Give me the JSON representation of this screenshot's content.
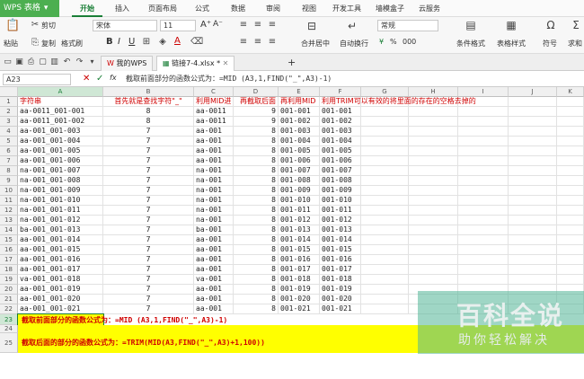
{
  "app": {
    "name": "WPS 表格",
    "dropdown": "▾"
  },
  "menu_tabs": [
    "开始",
    "插入",
    "页面布局",
    "公式",
    "数据",
    "审阅",
    "视图",
    "开发工具",
    "墙模盒子",
    "云服务"
  ],
  "ribbon": {
    "paste": "粘贴",
    "cut": "剪切",
    "copy": "复制",
    "format_painter": "格式刷",
    "font_name": "宋体",
    "font_size": "11",
    "bold": "B",
    "italic": "I",
    "underline": "U",
    "merge": "合并居中",
    "wrap": "自动换行",
    "number_format": "常规",
    "percent": "%",
    "thousands": "000",
    "conditional": "条件格式",
    "table_style": "表格样式",
    "symbol": "符号",
    "sum": "求和"
  },
  "doc_tabs": [
    {
      "label": "我的WPS"
    },
    {
      "label": "链接7-4.xlsx *"
    }
  ],
  "add_tab": "+",
  "formula_bar": {
    "name_box": "A23",
    "cancel": "✕",
    "confirm": "✓",
    "fx": "fx",
    "content": "截取前面部分的函数公式为：=MID (A3,1,FIND(\"_\",A3)-1)"
  },
  "columns": [
    "A",
    "B",
    "C",
    "D",
    "E",
    "F",
    "G",
    "H",
    "I",
    "J",
    "K"
  ],
  "rows": [
    {
      "n": "1",
      "a": "字符串",
      "b": "首先就是查找字符\"_\"",
      "c": "利用MID进",
      "d": "再截取后面",
      "e": "再利用MID",
      "f": "利用TRIM可以有效的将里面的存在的空格去掉的"
    },
    {
      "n": "2",
      "a": "aa-0011_001-001",
      "b": "8",
      "c": "aa-0011",
      "d": "9",
      "e": "001-001",
      "f": "001-001"
    },
    {
      "n": "3",
      "a": "aa-0011_001-002",
      "b": "8",
      "c": "aa-0011",
      "d": "9",
      "e": "001-002",
      "f": "001-002"
    },
    {
      "n": "4",
      "a": "aa-001_001-003",
      "b": "7",
      "c": "aa-001",
      "d": "8",
      "e": "001-003",
      "f": "001-003"
    },
    {
      "n": "5",
      "a": "aa-001_001-004",
      "b": "7",
      "c": "aa-001",
      "d": "8",
      "e": "001-004",
      "f": "001-004"
    },
    {
      "n": "6",
      "a": "aa-001_001-005",
      "b": "7",
      "c": "aa-001",
      "d": "8",
      "e": "001-005",
      "f": "001-005"
    },
    {
      "n": "7",
      "a": "aa-001_001-006",
      "b": "7",
      "c": "aa-001",
      "d": "8",
      "e": "001-006",
      "f": "001-006"
    },
    {
      "n": "8",
      "a": "na-001_001-007",
      "b": "7",
      "c": "na-001",
      "d": "8",
      "e": "001-007",
      "f": "001-007"
    },
    {
      "n": "9",
      "a": "na-001_001-008",
      "b": "7",
      "c": "na-001",
      "d": "8",
      "e": "001-008",
      "f": "001-008"
    },
    {
      "n": "10",
      "a": "na-001_001-009",
      "b": "7",
      "c": "na-001",
      "d": "8",
      "e": "001-009",
      "f": "001-009"
    },
    {
      "n": "11",
      "a": "na-001_001-010",
      "b": "7",
      "c": "na-001",
      "d": "8",
      "e": "001-010",
      "f": "001-010"
    },
    {
      "n": "12",
      "a": "na-001_001-011",
      "b": "7",
      "c": "na-001",
      "d": "8",
      "e": "001-011",
      "f": "001-011"
    },
    {
      "n": "13",
      "a": "na-001_001-012",
      "b": "7",
      "c": "na-001",
      "d": "8",
      "e": "001-012",
      "f": "001-012"
    },
    {
      "n": "14",
      "a": "ba-001_001-013",
      "b": "7",
      "c": "ba-001",
      "d": "8",
      "e": "001-013",
      "f": "001-013"
    },
    {
      "n": "15",
      "a": "aa-001_001-014",
      "b": "7",
      "c": "aa-001",
      "d": "8",
      "e": "001-014",
      "f": "001-014"
    },
    {
      "n": "16",
      "a": "aa-001_001-015",
      "b": "7",
      "c": "aa-001",
      "d": "8",
      "e": "001-015",
      "f": "001-015"
    },
    {
      "n": "17",
      "a": "aa-001_001-016",
      "b": "7",
      "c": "aa-001",
      "d": "8",
      "e": "001-016",
      "f": "001-016"
    },
    {
      "n": "18",
      "a": "aa-001_001-017",
      "b": "7",
      "c": "aa-001",
      "d": "8",
      "e": "001-017",
      "f": "001-017"
    },
    {
      "n": "19",
      "a": "va-001_001-018",
      "b": "7",
      "c": "va-001",
      "d": "8",
      "e": "001-018",
      "f": "001-018"
    },
    {
      "n": "20",
      "a": "aa-001_001-019",
      "b": "7",
      "c": "aa-001",
      "d": "8",
      "e": "001-019",
      "f": "001-019"
    },
    {
      "n": "21",
      "a": "aa-001_001-020",
      "b": "7",
      "c": "aa-001",
      "d": "8",
      "e": "001-020",
      "f": "001-020"
    },
    {
      "n": "22",
      "a": "aa-001_001-021",
      "b": "7",
      "c": "aa-001",
      "d": "8",
      "e": "001-021",
      "f": "001-021"
    }
  ],
  "notes": {
    "row23_n": "23",
    "row23": "截取前面部分的函数公式为：=MID (A3,1,FIND(\"_\",A3)-1)",
    "row24_n": "24",
    "row25_n": "25",
    "row25": "截取后面的部分的函数公式为：=TRIM(MID(A3,FIND(\"_\",A3)+1,100))"
  },
  "watermark": {
    "title": "百科全说",
    "subtitle": "助你轻松解决"
  },
  "colors": {
    "accent": "#1a7f37",
    "highlight": "#ffff00",
    "red_text": "#d00000"
  }
}
